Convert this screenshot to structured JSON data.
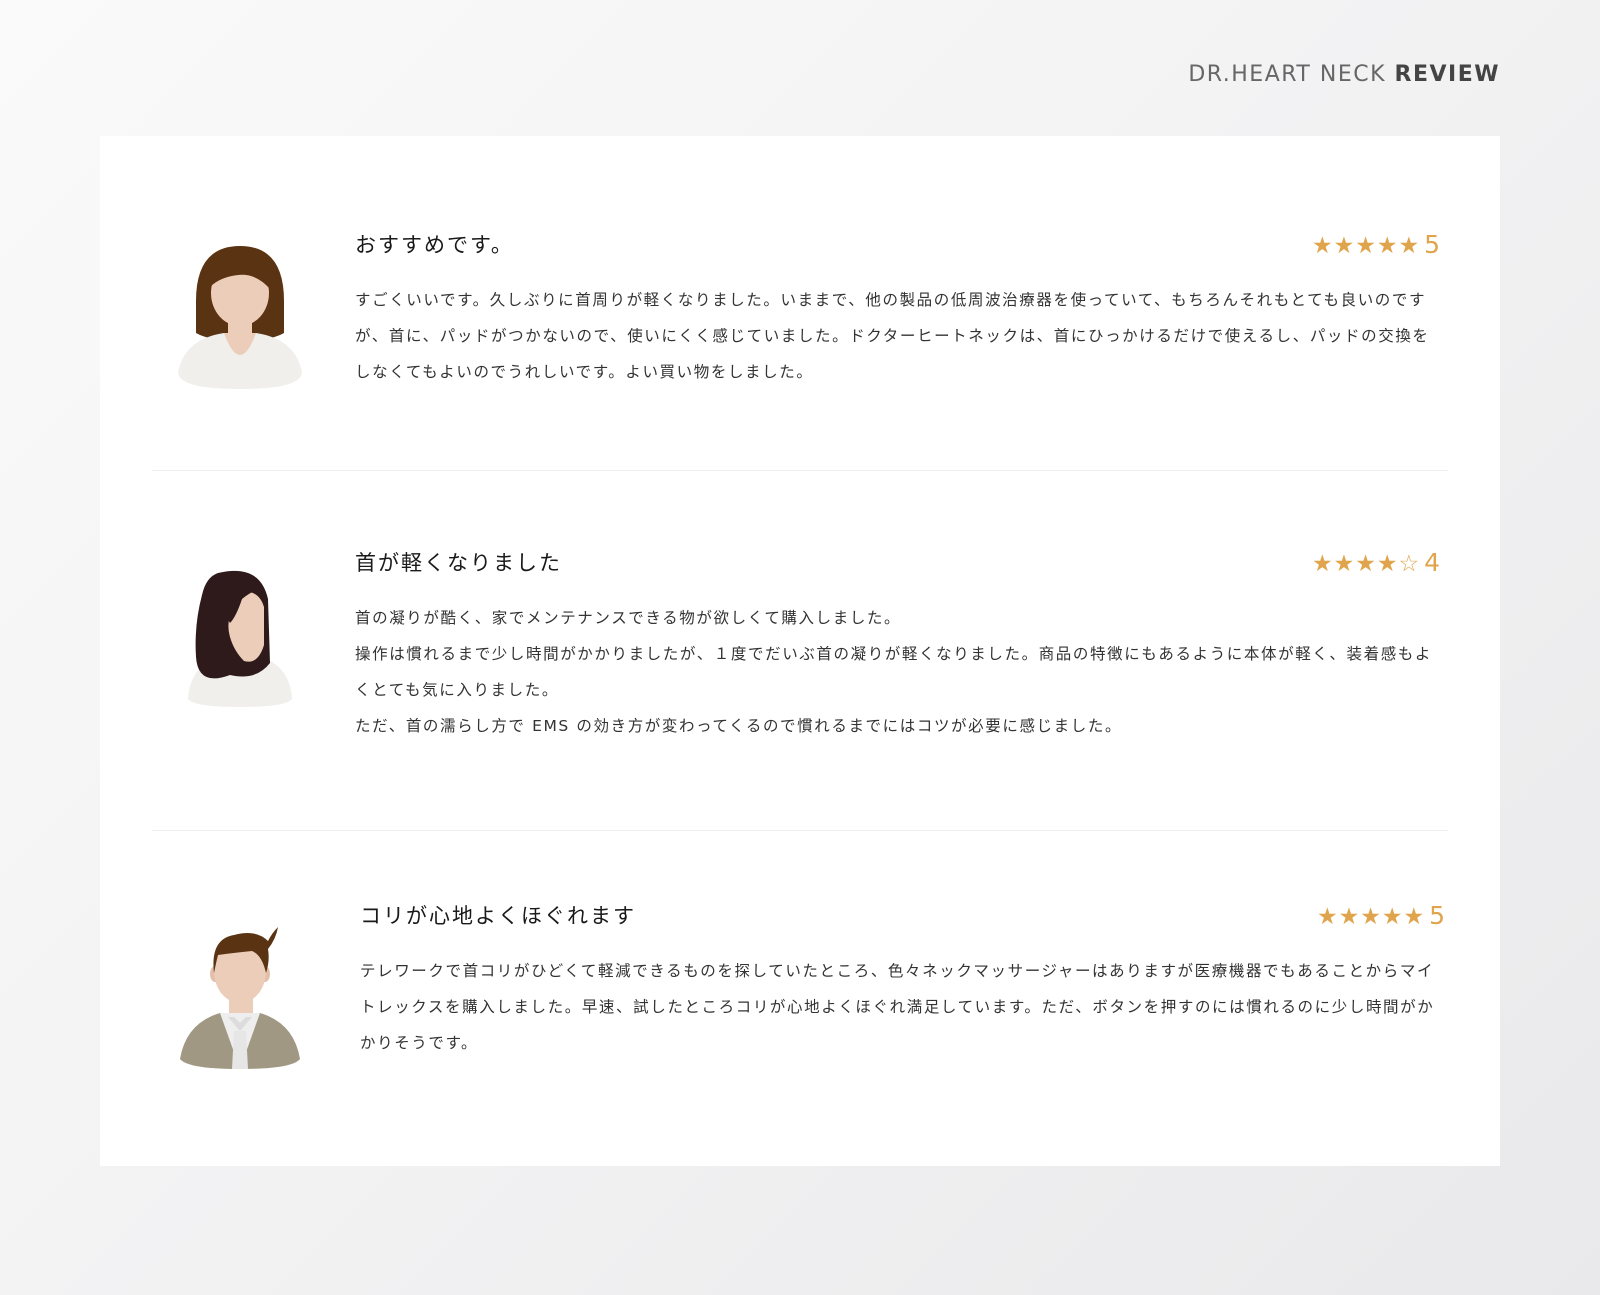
{
  "brand": {
    "light": "DR.HEART NECK",
    "bold": "REVIEW"
  },
  "colors": {
    "star": "#e0a54c",
    "card": "#ffffff"
  },
  "reviews": [
    {
      "avatar": "woman-short-hair-avatar",
      "title": "おすすめです。",
      "stars": "★★★★★",
      "rating": "5",
      "paragraphs": [
        "すごくいいです。久しぶりに首周りが軽くなりました。いままで、他の製品の低周波治療器を使っていて、もちろんそれもとても良いのですが、首に、パッドがつかないので、使いにくく感じていました。ドクターヒートネックは、首にひっかけるだけで使えるし、パッドの交換をしなくてもよいのでうれしいです。よい買い物をしました。"
      ]
    },
    {
      "avatar": "woman-long-hair-avatar",
      "title": "首が軽くなりました",
      "stars": "★★★★☆",
      "rating": "4",
      "paragraphs": [
        "首の凝りが酷く、家でメンテナンスできる物が欲しくて購入しました。",
        "操作は慣れるまで少し時間がかかりましたが、１度でだいぶ首の凝りが軽くなりました。商品の特徴にもあるように本体が軽く、装着感もよくとても気に入りました。",
        "ただ、首の濡らし方で EMS の効き方が変わってくるので慣れるまでにはコツが必要に感じました。"
      ]
    },
    {
      "avatar": "man-avatar",
      "title": "コリが心地よくほぐれます",
      "stars": "★★★★★",
      "rating": "5",
      "paragraphs": [
        "テレワークで首コリがひどくて軽減できるものを探していたところ、色々ネックマッサージャーはありますが医療機器でもあることからマイトレックスを購入しました。早速、試したところコリが心地よくほぐれ満足しています。ただ、ボタンを押すのには慣れるのに少し時間がかかりそうです。"
      ]
    }
  ]
}
